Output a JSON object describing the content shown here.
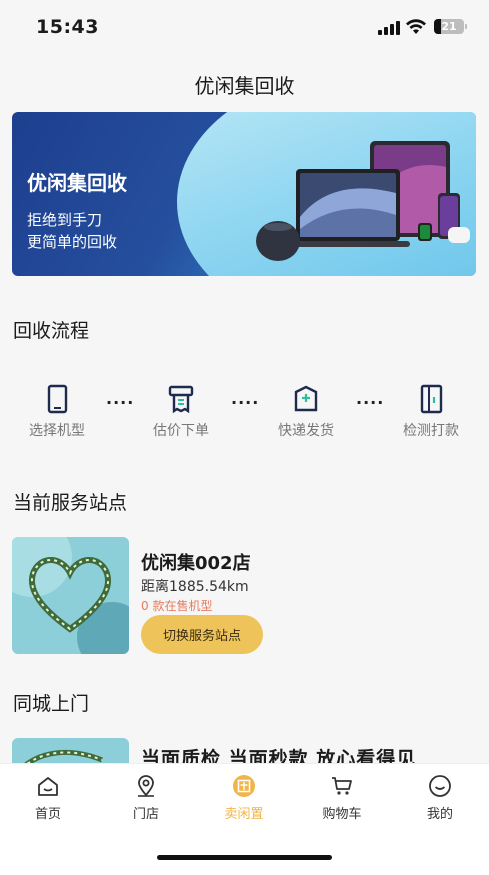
{
  "status_bar": {
    "time": "15:43",
    "battery_level": "21"
  },
  "nav": {
    "title": "优闲集回收"
  },
  "banner": {
    "title": "优闲集回收",
    "subtitle_line1": "拒绝到手刀",
    "subtitle_line2": "更简单的回收"
  },
  "process": {
    "title": "回收流程",
    "steps": [
      {
        "label": "选择机型",
        "icon": "phone-icon"
      },
      {
        "label": "估价下单",
        "icon": "receipt-icon"
      },
      {
        "label": "快递发货",
        "icon": "package-icon"
      },
      {
        "label": "检测打款",
        "icon": "inspection-icon"
      }
    ],
    "separator": "····"
  },
  "current_station": {
    "title": "当前服务站点",
    "store_name": "优闲集002店",
    "distance": "距离1885.54km",
    "stock": "0 款在售机型",
    "switch_label": "切换服务站点"
  },
  "city_service": {
    "title": "同城上门",
    "card_text": "当面质检  当面秒款  放心看得见"
  },
  "tabbar": {
    "active_color": "#f0b54a",
    "items": [
      {
        "label": "首页",
        "icon": "home-icon"
      },
      {
        "label": "门店",
        "icon": "location-pin-icon"
      },
      {
        "label": "卖闲置",
        "icon": "sell-idle-icon"
      },
      {
        "label": "购物车",
        "icon": "cart-icon"
      },
      {
        "label": "我的",
        "icon": "profile-icon"
      }
    ]
  }
}
